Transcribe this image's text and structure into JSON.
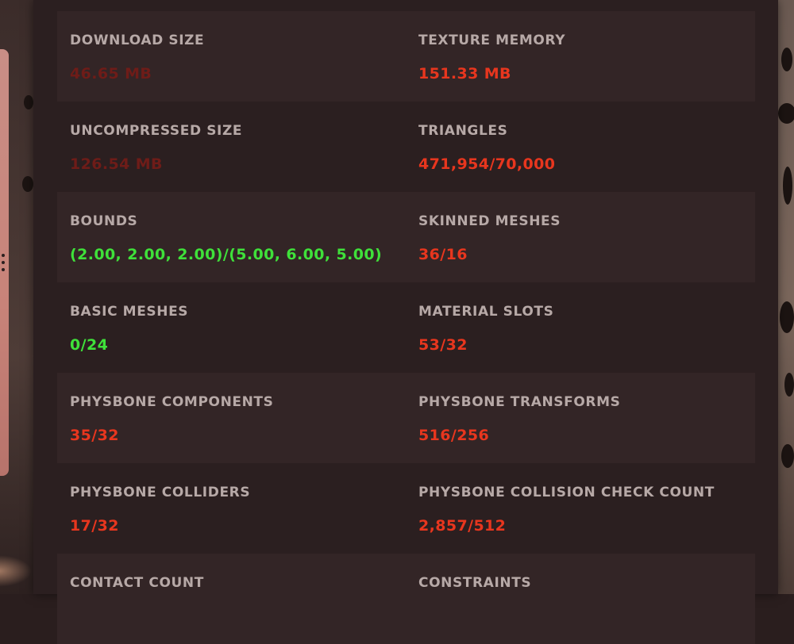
{
  "colors": {
    "bad": "#e8361e",
    "good": "#3fe13a",
    "faded": "#6e1c18",
    "label": "#b7a9a7"
  },
  "stats": [
    {
      "left": {
        "label": "DOWNLOAD SIZE",
        "value": "46.65 MB",
        "status": "faded"
      },
      "right": {
        "label": "TEXTURE MEMORY",
        "value": "151.33 MB",
        "status": "bad"
      }
    },
    {
      "left": {
        "label": "UNCOMPRESSED SIZE",
        "value": "126.54 MB",
        "status": "faded"
      },
      "right": {
        "label": "TRIANGLES",
        "value": "471,954/70,000",
        "status": "bad"
      }
    },
    {
      "left": {
        "label": "BOUNDS",
        "value": "(2.00, 2.00, 2.00)/(5.00, 6.00, 5.00)",
        "status": "good"
      },
      "right": {
        "label": "SKINNED MESHES",
        "value": "36/16",
        "status": "bad"
      }
    },
    {
      "left": {
        "label": "BASIC MESHES",
        "value": "0/24",
        "status": "good"
      },
      "right": {
        "label": "MATERIAL SLOTS",
        "value": "53/32",
        "status": "bad"
      }
    },
    {
      "left": {
        "label": "PHYSBONE COMPONENTS",
        "value": "35/32",
        "status": "bad"
      },
      "right": {
        "label": "PHYSBONE TRANSFORMS",
        "value": "516/256",
        "status": "bad"
      }
    },
    {
      "left": {
        "label": "PHYSBONE COLLIDERS",
        "value": "17/32",
        "status": "bad"
      },
      "right": {
        "label": "PHYSBONE COLLISION CHECK COUNT",
        "value": "2,857/512",
        "status": "bad"
      }
    },
    {
      "left": {
        "label": "CONTACT COUNT",
        "value": "",
        "status": "bad"
      },
      "right": {
        "label": "CONSTRAINTS",
        "value": "",
        "status": "bad"
      }
    }
  ]
}
